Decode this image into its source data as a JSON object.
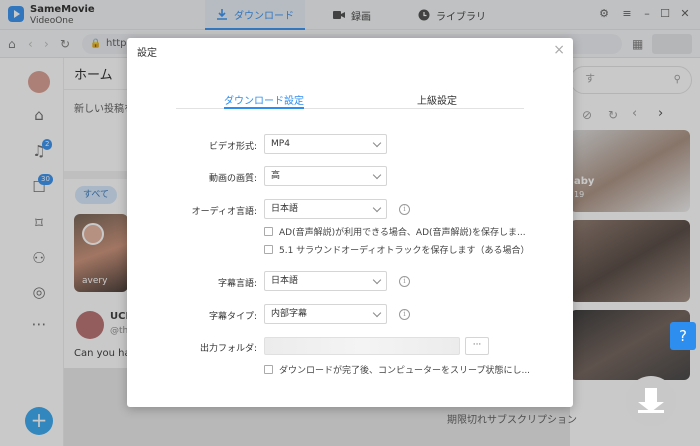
{
  "app": {
    "name": "SameMovie",
    "subtitle": "VideoOne"
  },
  "top_tabs": [
    {
      "label": "ダウンロード",
      "icon": "download-icon",
      "active": true
    },
    {
      "label": "録画",
      "icon": "video-camera-icon",
      "active": false
    },
    {
      "label": "ライブラリ",
      "icon": "clock-icon",
      "active": false
    }
  ],
  "browser": {
    "url": "https"
  },
  "sidebar": {
    "notifications_badge": "2",
    "messages_badge": "30"
  },
  "background": {
    "home_title": "ホーム",
    "post_placeholder": "新しい投稿を",
    "filter_all": "すべて",
    "card_name": "avery",
    "user_short": "UCL",
    "user_handle": "@th",
    "question": "Can you han",
    "search_hint": "す",
    "card_text": "aby",
    "card_date": "19",
    "expired_subs": "期限切れサブスクリプション"
  },
  "dialog": {
    "title": "設定",
    "tabs": [
      {
        "label": "ダウンロード設定",
        "active": true
      },
      {
        "label": "上級設定",
        "active": false
      }
    ],
    "fields": {
      "video_format": {
        "label": "ビデオ形式:",
        "value": "MP4"
      },
      "video_quality": {
        "label": "動画の画質:",
        "value": "高"
      },
      "audio_language": {
        "label": "オーディオ言語:",
        "value": "日本語"
      },
      "subtitle_language": {
        "label": "字幕言語:",
        "value": "日本語"
      },
      "subtitle_type": {
        "label": "字幕タイプ:",
        "value": "内部字幕"
      },
      "output_folder": {
        "label": "出力フォルダ:",
        "browse": "···"
      }
    },
    "checkboxes": {
      "ad": "AD(音声解説)が利用できる場合、AD(音声解説)を保存しま...",
      "surround": "5.1 サラウンドオーディオトラックを保存します（ある場合）",
      "sleep": "ダウンロードが完了後、コンピューターをスリープ状態にし..."
    }
  }
}
